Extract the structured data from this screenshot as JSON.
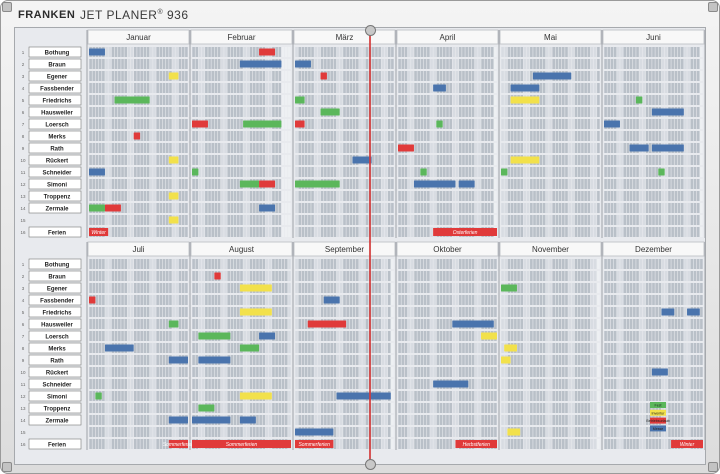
{
  "brand": {
    "name": "FRANKEN",
    "model": "JET PLANER",
    "model_sup": "®",
    "model_number": "936"
  },
  "rows": [
    {
      "no": "1",
      "name": "Bothung"
    },
    {
      "no": "2",
      "name": "Braun"
    },
    {
      "no": "3",
      "name": "Egener"
    },
    {
      "no": "4",
      "name": "Fassbender"
    },
    {
      "no": "5",
      "name": "Friedrichs"
    },
    {
      "no": "6",
      "name": "Hausweiler"
    },
    {
      "no": "7",
      "name": "Loersch"
    },
    {
      "no": "8",
      "name": "Merks"
    },
    {
      "no": "9",
      "name": "Rath"
    },
    {
      "no": "10",
      "name": "Rückert"
    },
    {
      "no": "11",
      "name": "Schneider"
    },
    {
      "no": "12",
      "name": "Simoni"
    },
    {
      "no": "13",
      "name": "Troppenz"
    },
    {
      "no": "14",
      "name": "Zermale"
    },
    {
      "no": "15",
      "name": ""
    },
    {
      "no": "16",
      "name": "Ferien"
    }
  ],
  "top_months": [
    "Januar",
    "Februar",
    "März",
    "April",
    "Mai",
    "Juni"
  ],
  "bottom_months": [
    "Juli",
    "August",
    "September",
    "Oktober",
    "November",
    "Dezember"
  ],
  "labels": {
    "ferien_jan": "Winter",
    "osterferien": "Osterferien",
    "sommerferien": "Sommerferien",
    "herbstferien": "Herbstferien",
    "winter_dec": "Winter",
    "dec_yellow": "Inventur",
    "dec_red": "Betriebsurlaub",
    "dec_blue": "Messe",
    "dec_green": "Fest"
  },
  "colors": {
    "blue": "#4a74ad",
    "green": "#5bb75b",
    "red": "#e03a3a",
    "yellow": "#f2e14b",
    "slot": "#b9c0c8",
    "weekend": "#d8dce2",
    "label_bg": "#ffffff"
  },
  "top_magnets": [
    {
      "half": "top",
      "row": 1,
      "month": 0,
      "startDay": 1,
      "endDay": 5,
      "color": "blue"
    },
    {
      "half": "top",
      "row": 1,
      "month": 1,
      "startDay": 22,
      "endDay": 26,
      "color": "red"
    },
    {
      "half": "top",
      "row": 2,
      "month": 1,
      "startDay": 16,
      "endDay": 28,
      "color": "blue"
    },
    {
      "half": "top",
      "row": 2,
      "month": 2,
      "startDay": 1,
      "endDay": 5,
      "color": "blue"
    },
    {
      "half": "top",
      "row": 3,
      "month": 2,
      "startDay": 9,
      "endDay": 10,
      "color": "red"
    },
    {
      "half": "top",
      "row": 3,
      "month": 0,
      "startDay": 26,
      "endDay": 28,
      "color": "yellow"
    },
    {
      "half": "top",
      "row": 3,
      "month": 4,
      "startDay": 11,
      "endDay": 22,
      "color": "blue"
    },
    {
      "half": "top",
      "row": 4,
      "month": 3,
      "startDay": 12,
      "endDay": 15,
      "color": "blue"
    },
    {
      "half": "top",
      "row": 4,
      "month": 4,
      "startDay": 4,
      "endDay": 12,
      "color": "blue"
    },
    {
      "half": "top",
      "row": 5,
      "month": 0,
      "startDay": 9,
      "endDay": 19,
      "color": "green"
    },
    {
      "half": "top",
      "row": 5,
      "month": 2,
      "startDay": 1,
      "endDay": 3,
      "color": "green"
    },
    {
      "half": "top",
      "row": 5,
      "month": 4,
      "startDay": 4,
      "endDay": 12,
      "color": "yellow"
    },
    {
      "half": "top",
      "row": 5,
      "month": 5,
      "startDay": 11,
      "endDay": 12,
      "color": "green"
    },
    {
      "half": "top",
      "row": 6,
      "month": 2,
      "startDay": 9,
      "endDay": 14,
      "color": "green"
    },
    {
      "half": "top",
      "row": 6,
      "month": 5,
      "startDay": 16,
      "endDay": 25,
      "color": "blue"
    },
    {
      "half": "top",
      "row": 7,
      "month": 1,
      "startDay": 1,
      "endDay": 5,
      "color": "red"
    },
    {
      "half": "top",
      "row": 7,
      "month": 1,
      "startDay": 17,
      "endDay": 28,
      "color": "green"
    },
    {
      "half": "top",
      "row": 7,
      "month": 2,
      "startDay": 1,
      "endDay": 3,
      "color": "red"
    },
    {
      "half": "top",
      "row": 7,
      "month": 3,
      "startDay": 13,
      "endDay": 14,
      "color": "green"
    },
    {
      "half": "top",
      "row": 7,
      "month": 5,
      "startDay": 1,
      "endDay": 5,
      "color": "blue"
    },
    {
      "half": "top",
      "row": 8,
      "month": 0,
      "startDay": 15,
      "endDay": 16,
      "color": "red"
    },
    {
      "half": "top",
      "row": 9,
      "month": 3,
      "startDay": 1,
      "endDay": 5,
      "color": "red"
    },
    {
      "half": "top",
      "row": 9,
      "month": 5,
      "startDay": 9,
      "endDay": 14,
      "color": "blue"
    },
    {
      "half": "top",
      "row": 9,
      "month": 5,
      "startDay": 16,
      "endDay": 25,
      "color": "blue"
    },
    {
      "half": "top",
      "row": 10,
      "month": 2,
      "startDay": 19,
      "endDay": 24,
      "color": "blue"
    },
    {
      "half": "top",
      "row": 10,
      "month": 0,
      "startDay": 26,
      "endDay": 28,
      "color": "yellow"
    },
    {
      "half": "top",
      "row": 10,
      "month": 4,
      "startDay": 4,
      "endDay": 12,
      "color": "yellow"
    },
    {
      "half": "top",
      "row": 11,
      "month": 0,
      "startDay": 1,
      "endDay": 5,
      "color": "blue"
    },
    {
      "half": "top",
      "row": 11,
      "month": 1,
      "startDay": 1,
      "endDay": 2,
      "color": "green"
    },
    {
      "half": "top",
      "row": 11,
      "month": 3,
      "startDay": 8,
      "endDay": 9,
      "color": "green"
    },
    {
      "half": "top",
      "row": 11,
      "month": 4,
      "startDay": 1,
      "endDay": 2,
      "color": "green"
    },
    {
      "half": "top",
      "row": 11,
      "month": 5,
      "startDay": 18,
      "endDay": 19,
      "color": "green"
    },
    {
      "half": "top",
      "row": 12,
      "month": 1,
      "startDay": 16,
      "endDay": 21,
      "color": "green"
    },
    {
      "half": "top",
      "row": 12,
      "month": 1,
      "startDay": 22,
      "endDay": 26,
      "color": "red"
    },
    {
      "half": "top",
      "row": 12,
      "month": 2,
      "startDay": 1,
      "endDay": 14,
      "color": "green"
    },
    {
      "half": "top",
      "row": 12,
      "month": 3,
      "startDay": 6,
      "endDay": 18,
      "color": "blue"
    },
    {
      "half": "top",
      "row": 12,
      "month": 3,
      "startDay": 20,
      "endDay": 24,
      "color": "blue"
    },
    {
      "half": "top",
      "row": 13,
      "month": 0,
      "startDay": 26,
      "endDay": 28,
      "color": "yellow"
    },
    {
      "half": "top",
      "row": 14,
      "month": 0,
      "startDay": 1,
      "endDay": 5,
      "color": "green"
    },
    {
      "half": "top",
      "row": 14,
      "month": 0,
      "startDay": 6,
      "endDay": 10,
      "color": "red"
    },
    {
      "half": "top",
      "row": 14,
      "month": 1,
      "startDay": 22,
      "endDay": 26,
      "color": "blue"
    },
    {
      "half": "top",
      "row": 15,
      "month": 0,
      "startDay": 26,
      "endDay": 28,
      "color": "yellow"
    }
  ],
  "bottom_magnets": [
    {
      "half": "bottom",
      "row": 2,
      "month": 1,
      "startDay": 8,
      "endDay": 9,
      "color": "red"
    },
    {
      "half": "bottom",
      "row": 3,
      "month": 1,
      "startDay": 16,
      "endDay": 25,
      "color": "yellow"
    },
    {
      "half": "bottom",
      "row": 4,
      "month": 2,
      "startDay": 10,
      "endDay": 14,
      "color": "blue"
    },
    {
      "half": "bottom",
      "row": 3,
      "month": 4,
      "startDay": 1,
      "endDay": 5,
      "color": "green"
    },
    {
      "half": "bottom",
      "row": 5,
      "month": 1,
      "startDay": 16,
      "endDay": 25,
      "color": "yellow"
    },
    {
      "half": "bottom",
      "row": 5,
      "month": 5,
      "startDay": 19,
      "endDay": 22,
      "color": "blue"
    },
    {
      "half": "bottom",
      "row": 5,
      "month": 5,
      "startDay": 27,
      "endDay": 30,
      "color": "blue"
    },
    {
      "half": "bottom",
      "row": 4,
      "month": 0,
      "startDay": 1,
      "endDay": 2,
      "color": "red"
    },
    {
      "half": "bottom",
      "row": 6,
      "month": 2,
      "startDay": 5,
      "endDay": 16,
      "color": "red"
    },
    {
      "half": "bottom",
      "row": 6,
      "month": 0,
      "startDay": 26,
      "endDay": 28,
      "color": "green"
    },
    {
      "half": "bottom",
      "row": 6,
      "month": 3,
      "startDay": 18,
      "endDay": 30,
      "color": "blue"
    },
    {
      "half": "bottom",
      "row": 7,
      "month": 1,
      "startDay": 3,
      "endDay": 12,
      "color": "green"
    },
    {
      "half": "bottom",
      "row": 7,
      "month": 1,
      "startDay": 22,
      "endDay": 26,
      "color": "blue"
    },
    {
      "half": "bottom",
      "row": 7,
      "month": 3,
      "startDay": 27,
      "endDay": 31,
      "color": "yellow"
    },
    {
      "half": "bottom",
      "row": 8,
      "month": 0,
      "startDay": 6,
      "endDay": 14,
      "color": "blue"
    },
    {
      "half": "bottom",
      "row": 8,
      "month": 1,
      "startDay": 16,
      "endDay": 21,
      "color": "green"
    },
    {
      "half": "bottom",
      "row": 8,
      "month": 4,
      "startDay": 2,
      "endDay": 5,
      "color": "yellow"
    },
    {
      "half": "bottom",
      "row": 9,
      "month": 0,
      "startDay": 26,
      "endDay": 31,
      "color": "blue"
    },
    {
      "half": "bottom",
      "row": 9,
      "month": 1,
      "startDay": 3,
      "endDay": 12,
      "color": "blue"
    },
    {
      "half": "bottom",
      "row": 9,
      "month": 4,
      "startDay": 1,
      "endDay": 3,
      "color": "yellow"
    },
    {
      "half": "bottom",
      "row": 10,
      "month": 5,
      "startDay": 16,
      "endDay": 20,
      "color": "blue"
    },
    {
      "half": "bottom",
      "row": 11,
      "month": 3,
      "startDay": 12,
      "endDay": 22,
      "color": "blue"
    },
    {
      "half": "bottom",
      "row": 12,
      "month": 0,
      "startDay": 3,
      "endDay": 4,
      "color": "green"
    },
    {
      "half": "bottom",
      "row": 12,
      "month": 1,
      "startDay": 16,
      "endDay": 25,
      "color": "yellow"
    },
    {
      "half": "bottom",
      "row": 12,
      "month": 2,
      "startDay": 14,
      "endDay": 30,
      "color": "blue"
    },
    {
      "half": "bottom",
      "row": 13,
      "month": 1,
      "startDay": 3,
      "endDay": 7,
      "color": "green"
    },
    {
      "half": "bottom",
      "row": 14,
      "month": 0,
      "startDay": 26,
      "endDay": 31,
      "color": "blue"
    },
    {
      "half": "bottom",
      "row": 14,
      "month": 1,
      "startDay": 1,
      "endDay": 12,
      "color": "blue"
    },
    {
      "half": "bottom",
      "row": 14,
      "month": 1,
      "startDay": 16,
      "endDay": 20,
      "color": "blue"
    },
    {
      "half": "bottom",
      "row": 15,
      "month": 2,
      "startDay": 1,
      "endDay": 12,
      "color": "blue"
    },
    {
      "half": "bottom",
      "row": 15,
      "month": 4,
      "startDay": 3,
      "endDay": 6,
      "color": "yellow"
    }
  ]
}
